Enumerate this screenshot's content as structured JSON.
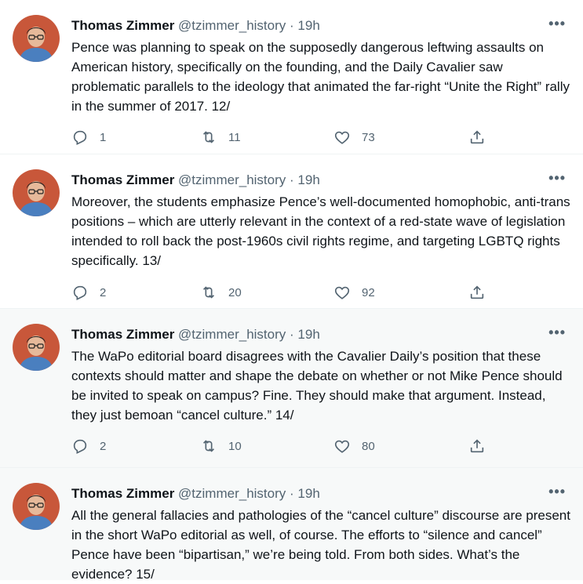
{
  "tweets": [
    {
      "name": "Thomas Zimmer",
      "handle": "@tzimmer_history",
      "sep": "·",
      "time": "19h",
      "text": "Pence was planning to speak on the supposedly dangerous leftwing assaults on American history, specifically on the founding, and the Daily Cavalier saw problematic parallels to the ideology that animated the far-right “Unite the Right” rally in the summer of 2017. 12/",
      "replies": "1",
      "retweets": "11",
      "likes": "73"
    },
    {
      "name": "Thomas Zimmer",
      "handle": "@tzimmer_history",
      "sep": "·",
      "time": "19h",
      "text": "Moreover, the students emphasize Pence’s well-documented homophobic, anti-trans positions – which are utterly relevant in the context of a red-state wave of legislation intended to roll back the post-1960s civil rights regime, and targeting LGBTQ rights specifically. 13/",
      "replies": "2",
      "retweets": "20",
      "likes": "92"
    },
    {
      "name": "Thomas Zimmer",
      "handle": "@tzimmer_history",
      "sep": "·",
      "time": "19h",
      "text": "The WaPo editorial board disagrees with the Cavalier Daily’s position that these contexts should matter and shape the debate on whether or not Mike Pence should be invited to speak on campus? Fine. They should make that argument. Instead, they just bemoan “cancel culture.” 14/",
      "replies": "2",
      "retweets": "10",
      "likes": "80"
    },
    {
      "name": "Thomas Zimmer",
      "handle": "@tzimmer_history",
      "sep": "·",
      "time": "19h",
      "text": "All the general fallacies and pathologies of the “cancel culture” discourse are present in the short WaPo editorial as well, of course. The efforts to “silence and cancel” Pence have been “bipartisan,” we’re being told. From both sides. What’s the evidence? 15/",
      "replies": "",
      "retweets": "",
      "likes": ""
    }
  ],
  "icons": {
    "more": "more-icon",
    "reply": "reply-icon",
    "retweet": "retweet-icon",
    "like": "like-icon",
    "share": "share-icon"
  },
  "colors": {
    "text": "#0f1419",
    "secondary": "#536471",
    "highlight_bg": "#f7f9f9",
    "divider": "#eff3f4"
  }
}
